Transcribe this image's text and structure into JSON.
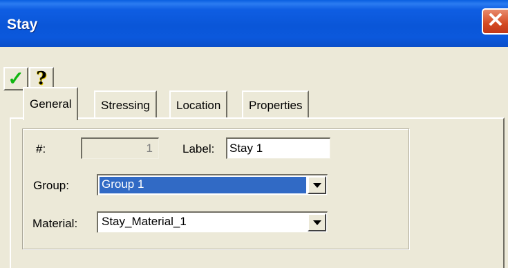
{
  "window": {
    "title": "Stay",
    "close_glyph": "✕"
  },
  "toolbar": {
    "ok_glyph": "✓",
    "help_glyph": "?"
  },
  "tabs": [
    {
      "label": "General",
      "active": true
    },
    {
      "label": "Stressing",
      "active": false
    },
    {
      "label": "Location",
      "active": false
    },
    {
      "label": "Properties",
      "active": false
    }
  ],
  "form": {
    "number_label": "#:",
    "number_value": "1",
    "label_label": "Label:",
    "label_value": "Stay 1",
    "group_label": "Group:",
    "group_value": "Group 1",
    "material_label": "Material:",
    "material_value": "Stay_Material_1"
  },
  "icons": {
    "ok": "check-icon",
    "help": "question-icon",
    "close": "close-icon",
    "dropdown": "chevron-down-icon"
  },
  "colors": {
    "titlebar": "#0a56d8",
    "close": "#d44a22",
    "selection": "#316ac5",
    "dialog": "#ece9d8"
  }
}
